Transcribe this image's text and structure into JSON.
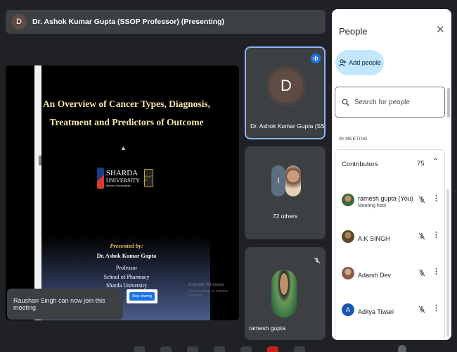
{
  "presenter": {
    "avatar_letter": "D",
    "label": "Dr. Ashok Kumar Gupta (SSOP Professor) (Presenting)"
  },
  "slide": {
    "title_line1": "An Overview of Cancer Types, Diagnosis,",
    "title_line2": "Treatment and Predictors of Outcome",
    "logo_line1": "SHARDA",
    "logo_line2": "UNIVERSITY",
    "logo_tagline": "Beyond Boundaries",
    "logo_badge": "NAAC A+",
    "presented_by": "Presented by:",
    "presenter_name": "Dr. Ashok Kumar Gupta",
    "presenter_role": "Professor",
    "presenter_school": "School of Pharmacy",
    "presenter_university": "Sharda University",
    "stop_sharing": "Stop sharing",
    "watermark_title": "Activate Windows",
    "watermark_sub": "Go to Settings to activate Windows."
  },
  "toast": {
    "message": "Raushan Singh can now join this meeting"
  },
  "tiles": {
    "main": {
      "avatar_letter": "D",
      "name": "Dr. Ashok Kumar Gupta (SSOP..."
    },
    "others": {
      "avatar_letter": "I",
      "label": "72 others"
    },
    "ramesh": {
      "name": "ramesh gupta"
    }
  },
  "people_panel": {
    "title": "People",
    "add_people": "Add people",
    "search_placeholder": "Search for people",
    "section_label": "IN MEETING",
    "contributors_label": "Contributors",
    "contributors_count": "75",
    "people": [
      {
        "name": "ramesh gupta (You)",
        "sub": "Meeting host",
        "avatar": "photo"
      },
      {
        "name": "A.K SINGH",
        "sub": "",
        "avatar": "photo"
      },
      {
        "name": "Adarsh Dev",
        "sub": "",
        "avatar": "photo"
      },
      {
        "name": "Aditya Tiwari",
        "sub": "",
        "avatar": "A"
      }
    ]
  },
  "colors": {
    "background": "#202124",
    "tile": "#3c4043",
    "accent_blue": "#1a73e8",
    "add_button": "#c2e7ff",
    "slide_title": "#f5e6a8"
  },
  "icons": [
    "close-icon",
    "add-person-icon",
    "search-icon",
    "chevron-up-icon",
    "mic-off-icon",
    "more-vert-icon",
    "audio-wave-icon"
  ]
}
